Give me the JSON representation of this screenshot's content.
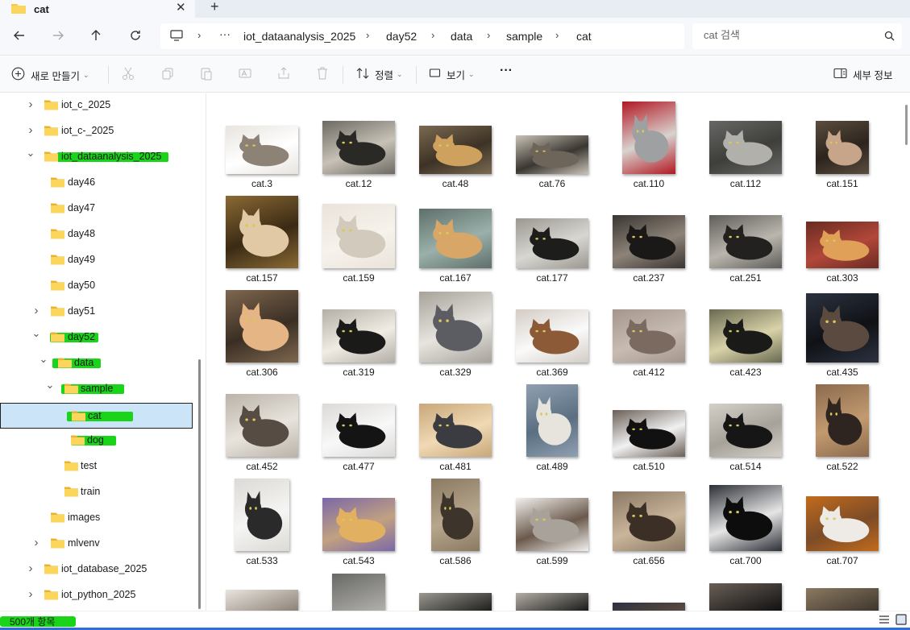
{
  "tab": {
    "title": "cat",
    "close_glyph": "✕",
    "new_glyph": "+"
  },
  "address": {
    "overflow_glyph": "···",
    "crumbs": [
      "iot_dataanalysis_2025",
      "day52",
      "data",
      "sample",
      "cat"
    ],
    "search_placeholder": "cat 검색"
  },
  "toolbar": {
    "new_label": "새로 만들기",
    "sort_label": "정렬",
    "view_label": "보기",
    "more_glyph": "···",
    "details_label": "세부 정보"
  },
  "sidebar": {
    "items": [
      {
        "label": "iot_c_2025",
        "chevron": "›"
      },
      {
        "label": "iot_c-_2025",
        "chevron": "›"
      },
      {
        "label": "iot_dataanalysis_2025",
        "chevron": "⌄"
      },
      {
        "label": "day46",
        "chevron": ""
      },
      {
        "label": "day47",
        "chevron": ""
      },
      {
        "label": "day48",
        "chevron": ""
      },
      {
        "label": "day49",
        "chevron": ""
      },
      {
        "label": "day50",
        "chevron": ""
      },
      {
        "label": "day51",
        "chevron": "›"
      },
      {
        "label": "day52",
        "chevron": "⌄"
      },
      {
        "label": "data",
        "chevron": "⌄"
      },
      {
        "label": "sample",
        "chevron": "⌄"
      },
      {
        "label": "cat",
        "chevron": ""
      },
      {
        "label": "dog",
        "chevron": ""
      },
      {
        "label": "test",
        "chevron": ""
      },
      {
        "label": "train",
        "chevron": ""
      },
      {
        "label": "images",
        "chevron": ""
      },
      {
        "label": "mlvenv",
        "chevron": "›"
      },
      {
        "label": "iot_database_2025",
        "chevron": "›"
      },
      {
        "label": "iot_python_2025",
        "chevron": "›"
      }
    ]
  },
  "files": [
    "cat.3",
    "cat.12",
    "cat.48",
    "cat.76",
    "cat.110",
    "cat.112",
    "cat.151",
    "cat.157",
    "cat.159",
    "cat.167",
    "cat.177",
    "cat.237",
    "cat.251",
    "cat.303",
    "cat.306",
    "cat.319",
    "cat.329",
    "cat.369",
    "cat.412",
    "cat.423",
    "cat.435",
    "cat.452",
    "cat.477",
    "cat.481",
    "cat.489",
    "cat.510",
    "cat.514",
    "cat.522",
    "cat.533",
    "cat.543",
    "cat.586",
    "cat.599",
    "cat.656",
    "cat.700",
    "cat.707"
  ],
  "status": {
    "count_label": "500개 항목"
  },
  "colors": {
    "highlight": "#19d419",
    "selection": "#cce4f7",
    "folder": "#f7c948"
  }
}
